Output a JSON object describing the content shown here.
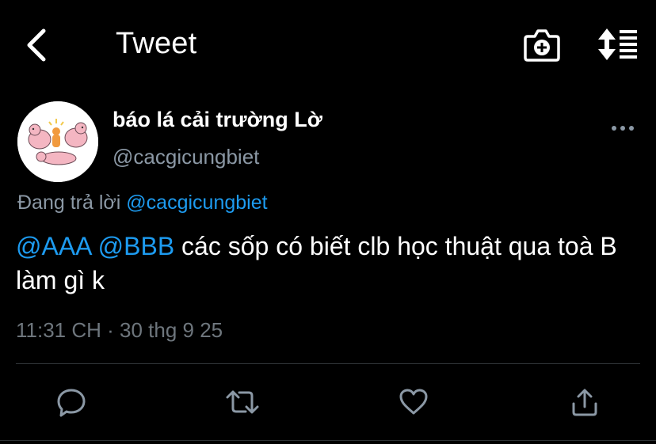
{
  "header": {
    "title": "Tweet",
    "back_icon": "chevron-left-icon",
    "camera_icon": "camera-plus-icon",
    "sort_icon": "sort-lines-icon"
  },
  "tweet": {
    "author": {
      "display_name": "báo lá cải trường Lờ",
      "handle": "@cacgicungbiet"
    },
    "reply_prefix": "Đang trả lời",
    "reply_to": "@cacgicungbiet",
    "mention_1": "@AAA",
    "mention_2": "@BBB",
    "body": "các sốp có biết clb học thuật qua toà B làm gì k",
    "timestamp": "11:31 CH · 30 thg 9 25"
  },
  "actions": {
    "reply_icon": "reply-bubble-icon",
    "retweet_icon": "retweet-icon",
    "like_icon": "heart-icon",
    "share_icon": "share-icon"
  },
  "colors": {
    "background": "#000000",
    "text": "#ffffff",
    "secondary": "#8b98a5",
    "accent": "#1d9bf0",
    "divider": "#2f3336"
  }
}
